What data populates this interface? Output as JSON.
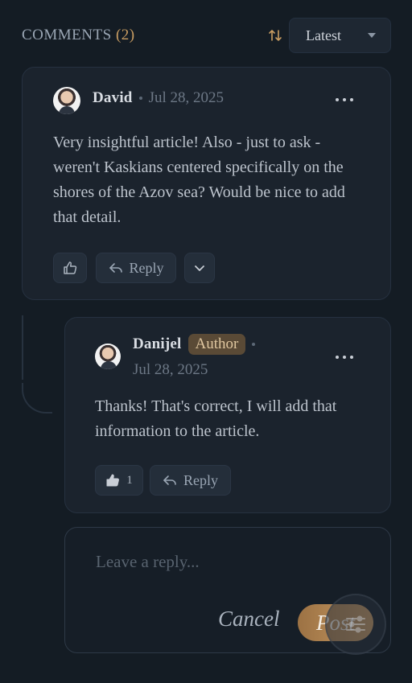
{
  "header": {
    "title": "COMMENTS",
    "count": "(2)",
    "sort_selected": "Latest",
    "sort_icon": "sort-arrows-icon"
  },
  "comments": [
    {
      "name": "David",
      "date": "Jul 28, 2025",
      "text": "Very insightful article! Also - just to ask - weren't Kaskians centered specifically on the shores of the Azov sea? Would be nice to add that detail.",
      "reply_label": "Reply",
      "likes": ""
    }
  ],
  "reply": {
    "name": "Danijel",
    "badge": "Author",
    "date": "Jul 28, 2025",
    "text": "Thanks! That's correct, I will add that information to the article.",
    "likes": "1",
    "reply_label": "Reply"
  },
  "composer": {
    "placeholder": "Leave a reply...",
    "cancel_label": "Cancel",
    "post_label": "Post"
  },
  "colors": {
    "accent": "#c99d62",
    "background": "#141c24",
    "card": "#1b232d",
    "badge_bg": "#5a4a36"
  }
}
